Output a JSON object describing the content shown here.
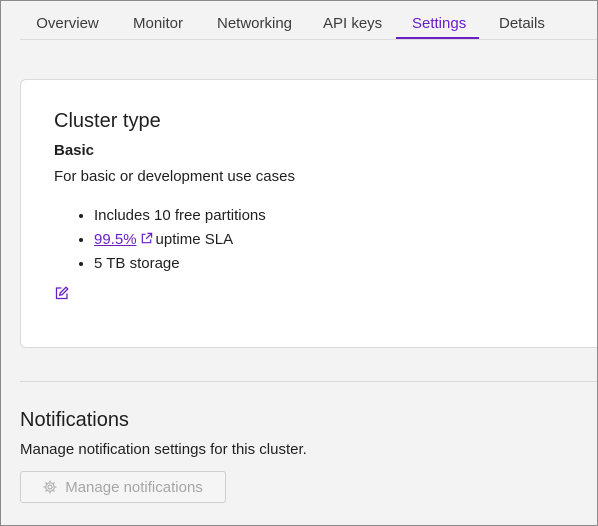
{
  "tabs": [
    {
      "label": "Overview"
    },
    {
      "label": "Monitor"
    },
    {
      "label": "Networking"
    },
    {
      "label": "API keys"
    },
    {
      "label": "Settings"
    },
    {
      "label": "Details"
    }
  ],
  "active_tab": "Settings",
  "cluster": {
    "title": "Cluster type",
    "type": "Basic",
    "description": "For basic or development use cases",
    "features": {
      "partitions": "Includes 10 free partitions",
      "sla_link": "99.5%",
      "sla_suffix": "uptime SLA",
      "storage": "5 TB storage"
    },
    "edit_icon": "edit-icon"
  },
  "notifications": {
    "title": "Notifications",
    "description": "Manage notification settings for this cluster.",
    "button_label": "Manage notifications",
    "button_icon": "gear-icon",
    "button_disabled": true
  },
  "colors": {
    "accent": "#6a1ec6",
    "background": "#f3f3f3",
    "card": "#ffffff",
    "text": "#1f1f1f",
    "disabled_text": "#a6a6a6"
  }
}
